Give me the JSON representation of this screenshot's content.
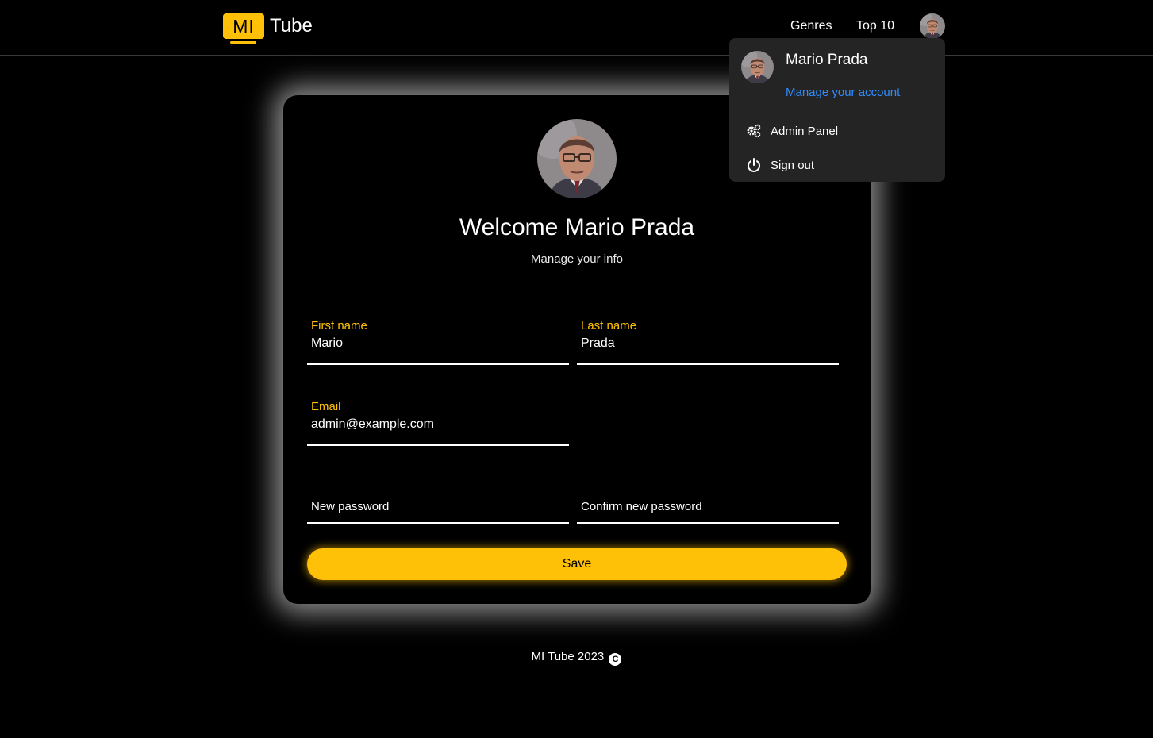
{
  "header": {
    "logo_badge": "MI",
    "logo_text": "Tube",
    "nav": {
      "genres": "Genres",
      "top10": "Top 10"
    }
  },
  "dropdown": {
    "user_name": "Mario Prada",
    "manage_account": "Manage your account",
    "items": [
      {
        "label": "Admin Panel",
        "icon": "gears-icon"
      },
      {
        "label": "Sign out",
        "icon": "power-icon"
      }
    ]
  },
  "profile": {
    "welcome": "Welcome Mario Prada",
    "subtitle": "Manage your info"
  },
  "form": {
    "first_name": {
      "label": "First name",
      "value": "Mario"
    },
    "last_name": {
      "label": "Last name",
      "value": "Prada"
    },
    "email": {
      "label": "Email",
      "value": "admin@example.com"
    },
    "new_password": {
      "placeholder": "New password"
    },
    "confirm_password": {
      "placeholder": "Confirm new password"
    },
    "save_label": "Save"
  },
  "footer": {
    "text": "MI Tube 2023",
    "copyright_symbol": "C"
  },
  "colors": {
    "accent": "#ffc107",
    "link": "#2f8cff",
    "background": "#000000",
    "dropdown_bg": "#242424"
  }
}
